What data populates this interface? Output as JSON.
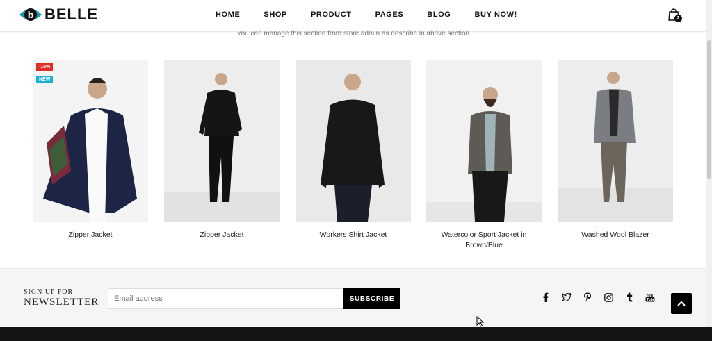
{
  "header": {
    "logo_text": "BELLE",
    "logo_letter": "b",
    "nav": [
      "HOME",
      "SHOP",
      "PRODUCT",
      "PAGES",
      "BLOG",
      "BUY NOW!"
    ],
    "cart_count": "2"
  },
  "section": {
    "subtitle": "You can manage this section from store admin as describe in above section"
  },
  "products": [
    {
      "name": "Zipper Jacket",
      "badges": [
        "-16%",
        "NEW"
      ],
      "jacket_color": "#1d2547"
    },
    {
      "name": "Zipper Jacket",
      "badges": [],
      "jacket_color": "#151515"
    },
    {
      "name": "Workers Shirt Jacket",
      "badges": [],
      "jacket_color": "#181818"
    },
    {
      "name": "Watercolor Sport Jacket in Brown/Blue",
      "badges": [],
      "jacket_color": "#5e5a55"
    },
    {
      "name": "Washed Wool Blazer",
      "badges": [],
      "jacket_color": "#7a7d82"
    }
  ],
  "newsletter": {
    "label_small": "SIGN UP FOR",
    "label_big": "NEWSLETTER",
    "email_placeholder": "Email address",
    "subscribe_label": "SUBSCRIBE"
  },
  "social_icons": [
    "facebook-icon",
    "twitter-icon",
    "pinterest-icon",
    "instagram-icon",
    "tumblr-icon",
    "youtube-icon"
  ],
  "colors": {
    "accent_teal": "#1a9ba8",
    "sale_red": "#e02b27",
    "new_blue": "#1ab0d4"
  }
}
